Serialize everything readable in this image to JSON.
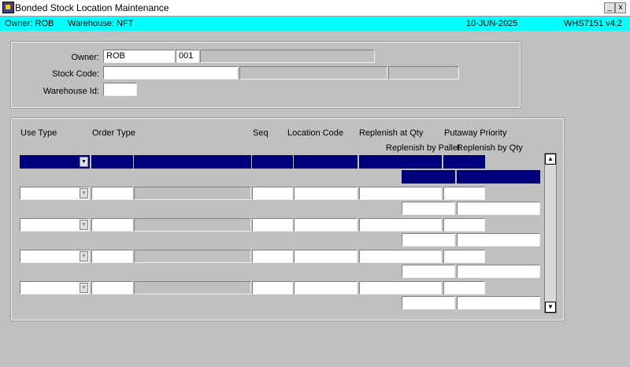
{
  "window": {
    "title": "Bonded Stock Location Maintenance",
    "minimize": "_",
    "close": "x"
  },
  "infobar": {
    "owner": "Owner:  ROB",
    "warehouse": "Warehouse:  NFT",
    "date": "10-JUN-2025",
    "program": "WHS7151  v4.2"
  },
  "header": {
    "owner_label": "Owner:",
    "owner_value": "ROB",
    "owner_code": "001",
    "stock_code_label": "Stock Code:",
    "stock_code_value": "",
    "warehouse_id_label": "Warehouse Id:",
    "warehouse_id_value": ""
  },
  "grid": {
    "columns": {
      "use_type": "Use Type",
      "order_type": "Order Type",
      "seq": "Seq",
      "location_code": "Location Code",
      "replenish_at_qty": "Replenish at Qty",
      "putaway_priority": "Putaway Priority",
      "replenish_by_pallet": "Replenish by Pallet",
      "replenish_by_qty": "Replenish by Qty"
    },
    "rows": [
      {
        "selected": true
      },
      {
        "selected": false
      },
      {
        "selected": false
      },
      {
        "selected": false
      },
      {
        "selected": false
      }
    ]
  },
  "colors": {
    "selected": "#00007f",
    "infobar": "#00ffff",
    "background": "#c0c0c0"
  }
}
